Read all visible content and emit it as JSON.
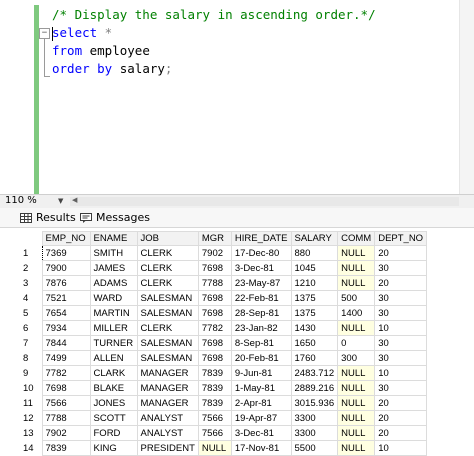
{
  "editor": {
    "comment": "/* Display the salary in ascending order.*/",
    "line2_keyword": "select",
    "line2_rest": " *",
    "line3_keyword": "from",
    "line3_rest": " employee",
    "line4_keyword": "order by",
    "line4_rest": " salary",
    "line4_end": ";",
    "collapse_glyph": "−",
    "colors": {
      "comment": "#008000",
      "keyword": "#0000ff",
      "change_bar": "#7fc97f"
    }
  },
  "status": {
    "zoom": "110 %",
    "zoom_dropdown_icon": "chevron-down-icon",
    "scroll_left_icon": "arrow-left-icon"
  },
  "tabs": [
    {
      "label": "Results",
      "icon": "grid-icon"
    },
    {
      "label": "Messages",
      "icon": "messages-icon"
    }
  ],
  "grid": {
    "columns": [
      "EMP_NO",
      "ENAME",
      "JOB",
      "MGR",
      "HIRE_DATE",
      "SALARY",
      "COMM",
      "DEPT_NO"
    ],
    "rows": [
      [
        "1",
        "7369",
        "SMITH",
        "CLERK",
        "7902",
        "17-Dec-80",
        "880",
        "NULL",
        "20"
      ],
      [
        "2",
        "7900",
        "JAMES",
        "CLERK",
        "7698",
        "3-Dec-81",
        "1045",
        "NULL",
        "30"
      ],
      [
        "3",
        "7876",
        "ADAMS",
        "CLERK",
        "7788",
        "23-May-87",
        "1210",
        "NULL",
        "20"
      ],
      [
        "4",
        "7521",
        "WARD",
        "SALESMAN",
        "7698",
        "22-Feb-81",
        "1375",
        "500",
        "30"
      ],
      [
        "5",
        "7654",
        "MARTIN",
        "SALESMAN",
        "7698",
        "28-Sep-81",
        "1375",
        "1400",
        "30"
      ],
      [
        "6",
        "7934",
        "MILLER",
        "CLERK",
        "7782",
        "23-Jan-82",
        "1430",
        "NULL",
        "10"
      ],
      [
        "7",
        "7844",
        "TURNER",
        "SALESMAN",
        "7698",
        "8-Sep-81",
        "1650",
        "0",
        "30"
      ],
      [
        "8",
        "7499",
        "ALLEN",
        "SALESMAN",
        "7698",
        "20-Feb-81",
        "1760",
        "300",
        "30"
      ],
      [
        "9",
        "7782",
        "CLARK",
        "MANAGER",
        "7839",
        "9-Jun-81",
        "2483.712",
        "NULL",
        "10"
      ],
      [
        "10",
        "7698",
        "BLAKE",
        "MANAGER",
        "7839",
        "1-May-81",
        "2889.216",
        "NULL",
        "30"
      ],
      [
        "11",
        "7566",
        "JONES",
        "MANAGER",
        "7839",
        "2-Apr-81",
        "3015.936",
        "NULL",
        "20"
      ],
      [
        "12",
        "7788",
        "SCOTT",
        "ANALYST",
        "7566",
        "19-Apr-87",
        "3300",
        "NULL",
        "20"
      ],
      [
        "13",
        "7902",
        "FORD",
        "ANALYST",
        "7566",
        "3-Dec-81",
        "3300",
        "NULL",
        "20"
      ],
      [
        "14",
        "7839",
        "KING",
        "PRESIDENT",
        "NULL",
        "17-Nov-81",
        "5500",
        "NULL",
        "10"
      ]
    ],
    "null_cell_color": "#ffffe1"
  }
}
